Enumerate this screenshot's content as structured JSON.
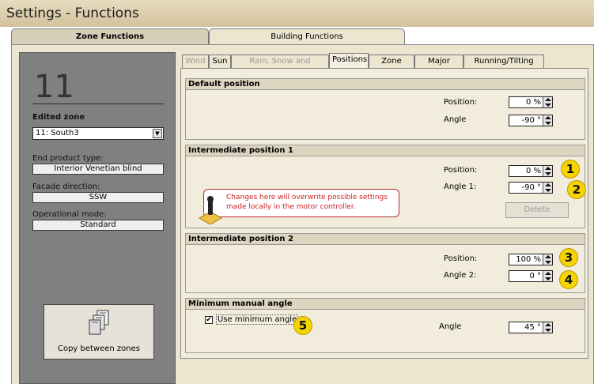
{
  "window": {
    "title": "Settings - Functions"
  },
  "top_tabs": [
    {
      "label": "Zone Functions",
      "active": true
    },
    {
      "label": "Building Functions",
      "active": false
    }
  ],
  "left_panel": {
    "zone_number": "11",
    "edited_zone_label": "Edited zone",
    "zone_select_value": "11: South3",
    "end_product_label": "End product type:",
    "end_product_value": "Interior Venetian blind",
    "facade_label": "Facade direction:",
    "facade_value": "SSW",
    "mode_label": "Operational mode:",
    "mode_value": "Standard",
    "copy_button_label": "Copy between zones"
  },
  "sub_tabs": [
    {
      "label": "Wind",
      "enabled": false
    },
    {
      "label": "Sun",
      "enabled": true
    },
    {
      "label": "Rain, Snow and Frost/Ice",
      "enabled": false
    },
    {
      "label": "Positions",
      "enabled": true,
      "active": true
    },
    {
      "label": "Zone Timer",
      "enabled": true
    },
    {
      "label": "Major Alarm",
      "enabled": true
    },
    {
      "label": "Running/Tilting Time",
      "enabled": true
    }
  ],
  "groups": {
    "default": {
      "title": "Default position",
      "position_label": "Position:",
      "position_value": "0 %",
      "angle_label": "Angle",
      "angle_value": "-90 °"
    },
    "intermediate1": {
      "title": "Intermediate position 1",
      "position_label": "Position:",
      "position_value": "0 %",
      "angle_label": "Angle 1:",
      "angle_value": "-90 °",
      "delete_label": "Delete",
      "warning_text": "Changes here will overwrite possible settings made locally in the motor controller."
    },
    "intermediate2": {
      "title": "Intermediate position 2",
      "position_label": "Position:",
      "position_value": "100 %",
      "angle_label": "Angle 2:",
      "angle_value": "0 °"
    },
    "minimum": {
      "title": "Minimum manual angle",
      "checkbox_label": "Use minimum angle",
      "checked": true,
      "check_mark": "✔",
      "angle_label": "Angle",
      "angle_value": "45 °"
    }
  },
  "badges": [
    "1",
    "2",
    "3",
    "4",
    "5"
  ],
  "colors": {
    "badge": "#f5d400",
    "warning_text": "#cc2020"
  }
}
